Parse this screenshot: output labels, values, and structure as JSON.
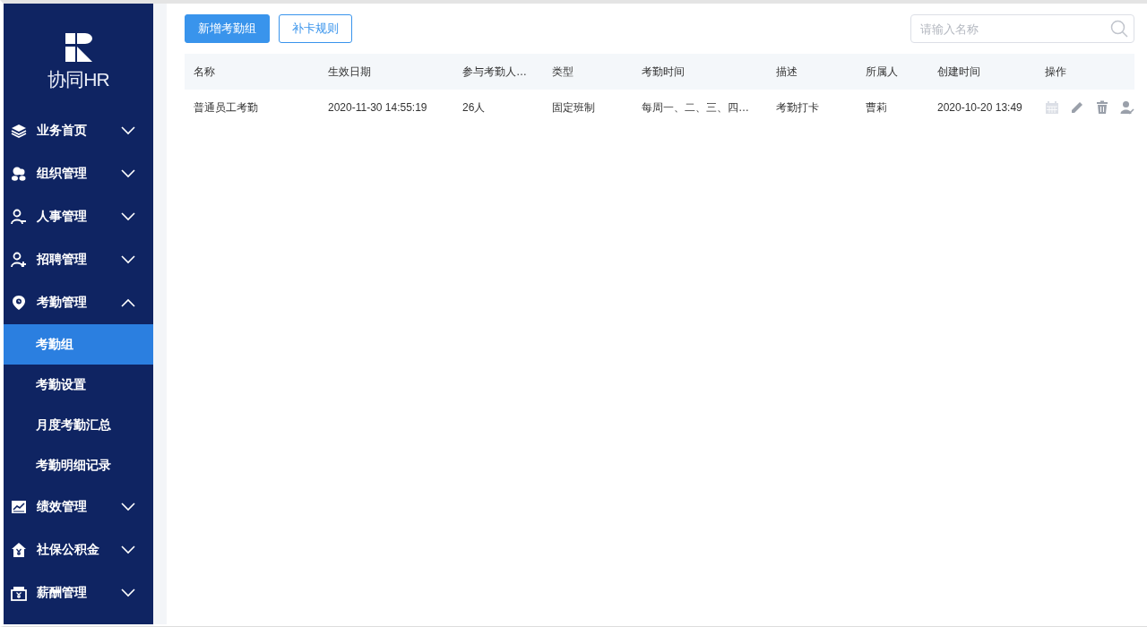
{
  "sidebar": {
    "logo": "协同HR",
    "menu": [
      {
        "label": "业务首页",
        "kind": "layers",
        "expanded": false
      },
      {
        "label": "组织管理",
        "kind": "org",
        "expanded": false
      },
      {
        "label": "人事管理",
        "kind": "person-minus",
        "expanded": false
      },
      {
        "label": "招聘管理",
        "kind": "person-plus",
        "expanded": false
      },
      {
        "label": "考勤管理",
        "kind": "pin",
        "expanded": true,
        "children": [
          {
            "label": "考勤组",
            "selected": true
          },
          {
            "label": "考勤设置",
            "selected": false
          },
          {
            "label": "月度考勤汇总",
            "selected": false
          },
          {
            "label": "考勤明细记录",
            "selected": false
          }
        ]
      },
      {
        "label": "绩效管理",
        "kind": "chart",
        "expanded": false
      },
      {
        "label": "社保公积金",
        "kind": "house",
        "expanded": false
      },
      {
        "label": "薪酬管理",
        "kind": "register",
        "expanded": false
      }
    ]
  },
  "toolbar": {
    "buttons": [
      {
        "label": "新增考勤组",
        "kind": "primary"
      },
      {
        "label": "补卡规则",
        "kind": "outline"
      }
    ],
    "search": {
      "placeholder": "请输入名称"
    }
  },
  "table": {
    "columns": [
      "名称",
      "生效日期",
      "参与考勤人…",
      "类型",
      "考勤时间",
      "描述",
      "所属人",
      "创建时间",
      "操作"
    ],
    "rows": [
      {
        "cells": [
          "普通员工考勤",
          "2020-11-30 14:55:19",
          "26人",
          "固定班制",
          "每周一、二、三、四…",
          "考勤打卡",
          "曹莉",
          "2020-10-20 13:49"
        ],
        "actions": [
          {
            "kind": "calendar",
            "disabled": true
          },
          {
            "kind": "edit",
            "disabled": false
          },
          {
            "kind": "delete",
            "disabled": false
          },
          {
            "kind": "assign",
            "disabled": false
          }
        ]
      }
    ]
  }
}
